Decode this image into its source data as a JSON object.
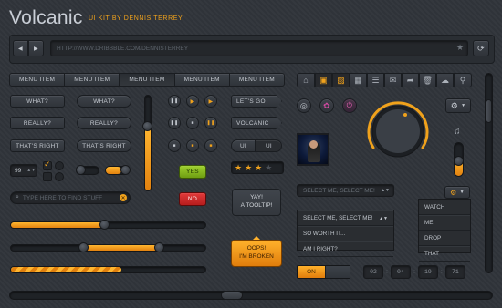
{
  "header": {
    "title": "Volcanic",
    "subtitle": "UI KIT BY DENNIS TERREY"
  },
  "browser": {
    "url": "HTTP://WWW.DRIBBBLE.COM/DENNISTERREY",
    "back": "◀",
    "forward": "▶",
    "star": "★",
    "refresh": "⟳"
  },
  "menu": {
    "items": [
      "MENU ITEM",
      "MENU ITEM",
      "MENU ITEM",
      "MENU ITEM",
      "MENU ITEM"
    ],
    "active_index": 2
  },
  "buttons": {
    "what": "WHAT?",
    "really": "REALLY?",
    "thats_right": "THAT'S RIGHT",
    "lets_go": "LET'S GO",
    "volcanic": "VOLCANIC",
    "ui_left": "UI",
    "ui_right": "UI",
    "yes": "YES",
    "no": "NO",
    "on": "ON"
  },
  "stepper": {
    "value": "99"
  },
  "search": {
    "placeholder": "TYPE HERE TO FIND STUFF"
  },
  "tooltips": {
    "tooltip": "YAY!\nA TOOLTIP!",
    "error": "OOPS!\nI'M BROKEN"
  },
  "rating": {
    "value": 3,
    "max": 4
  },
  "selects": {
    "collapsed": "SELECT ME, SELECT ME!",
    "open": "SELECT ME, SELECT ME!",
    "options": [
      "SO WORTH IT...",
      "AM I RIGHT?"
    ]
  },
  "context_menu": {
    "items": [
      "WATCH",
      "ME",
      "DROP",
      "THAT"
    ]
  },
  "counter": {
    "digits": [
      "02",
      "04",
      "19",
      "71"
    ]
  },
  "sliders": {
    "progress_1": 0.48,
    "range_start": 0.37,
    "range_end": 0.76,
    "progress_striped": 0.57,
    "vertical": 0.68,
    "bottom_scroll": 0.46
  },
  "icons": [
    "home-icon",
    "image-icon",
    "picture-icon",
    "grid-icon",
    "list-icon",
    "mail-icon",
    "share-icon",
    "trash-icon",
    "cloud-icon",
    "pin-icon"
  ],
  "colors": {
    "accent": "#f0a21c",
    "green": "#8dc21f",
    "red": "#d42a2a",
    "bg": "#30343a"
  }
}
